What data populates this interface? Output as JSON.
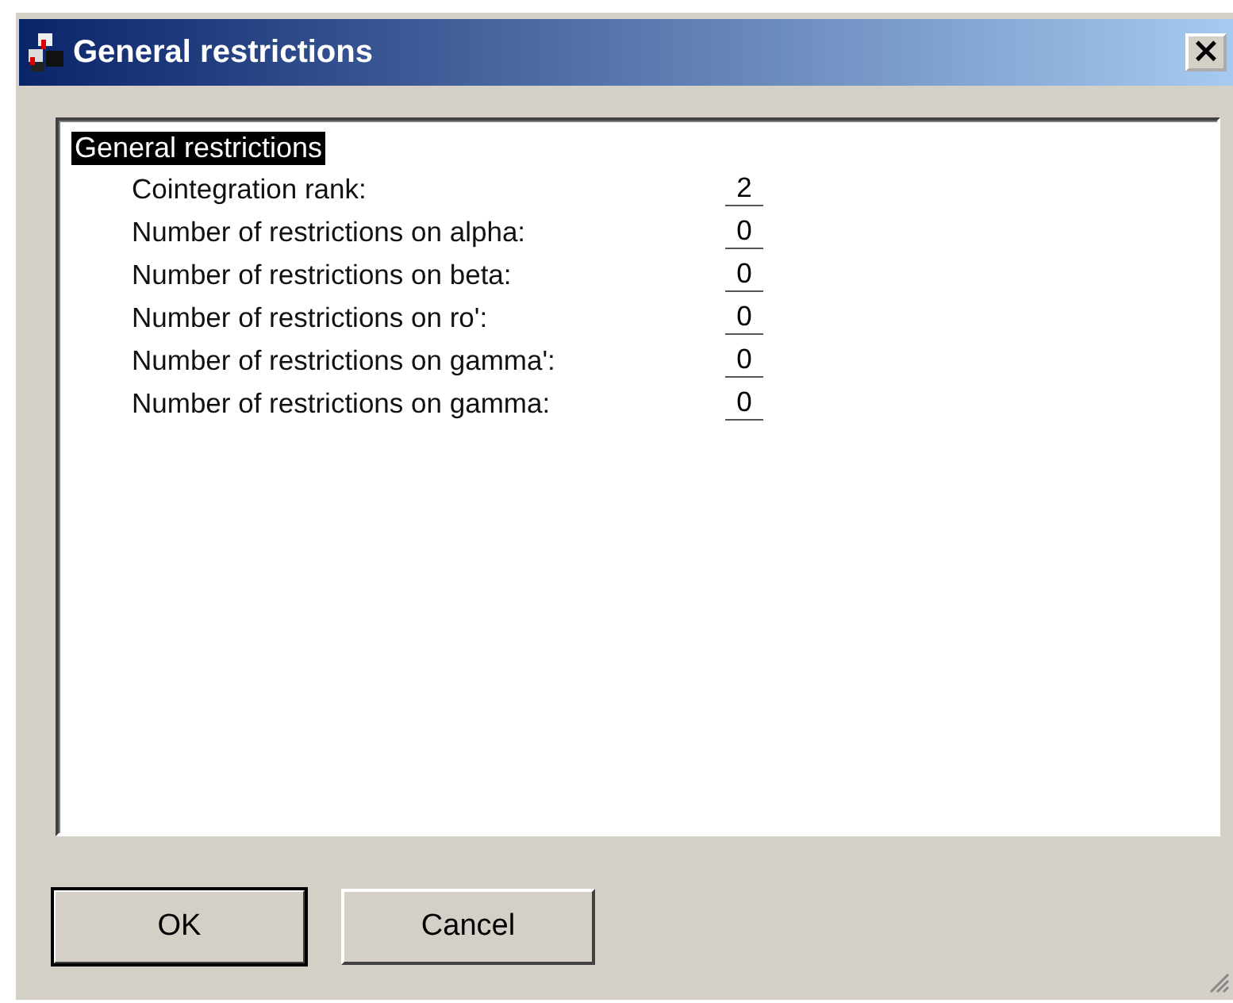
{
  "window": {
    "title": "General restrictions",
    "close": "×"
  },
  "group": {
    "title": "General restrictions",
    "selected": true
  },
  "fields": [
    {
      "label": "Cointegration rank:",
      "value": "2"
    },
    {
      "label": "Number of restrictions on alpha:",
      "value": "0"
    },
    {
      "label": "Number of restrictions on beta:",
      "value": "0"
    },
    {
      "label": "Number of restrictions on ro':",
      "value": "0"
    },
    {
      "label": "Number of restrictions on gamma':",
      "value": "0"
    },
    {
      "label": "Number of restrictions on gamma:",
      "value": "0"
    }
  ],
  "buttons": [
    {
      "label": "OK",
      "default": true
    },
    {
      "label": "Cancel",
      "default": false
    }
  ]
}
